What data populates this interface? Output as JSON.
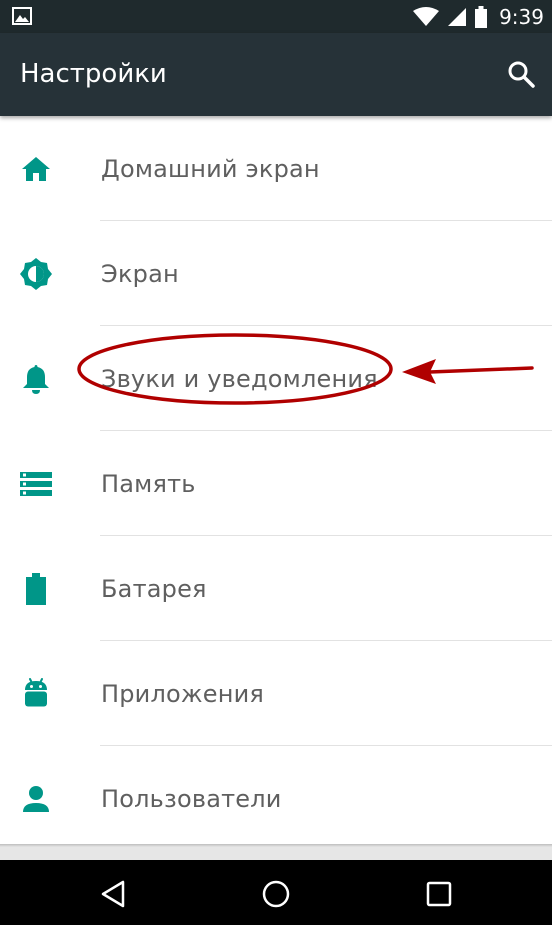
{
  "status_bar": {
    "time": "9:39",
    "icons": [
      "image-notification-icon",
      "wifi-icon",
      "cell-signal-icon",
      "battery-icon"
    ]
  },
  "toolbar": {
    "title": "Настройки",
    "search_icon": "search-icon"
  },
  "settings": {
    "items": [
      {
        "label": "Домашний экран",
        "icon": "home-icon"
      },
      {
        "label": "Экран",
        "icon": "brightness-icon"
      },
      {
        "label": "Звуки и уведомления",
        "icon": "bell-icon"
      },
      {
        "label": "Память",
        "icon": "storage-icon"
      },
      {
        "label": "Батарея",
        "icon": "battery-icon"
      },
      {
        "label": "Приложения",
        "icon": "android-icon"
      },
      {
        "label": "Пользователи",
        "icon": "person-icon"
      }
    ]
  },
  "nav_bar": {
    "buttons": [
      "back-icon",
      "home-circle-icon",
      "recents-icon"
    ]
  },
  "colors": {
    "accent": "#009688",
    "toolbar": "#263238",
    "status_bar": "#1f2a2d",
    "annotation": "#b00000",
    "label_text": "#5f5f5f"
  }
}
